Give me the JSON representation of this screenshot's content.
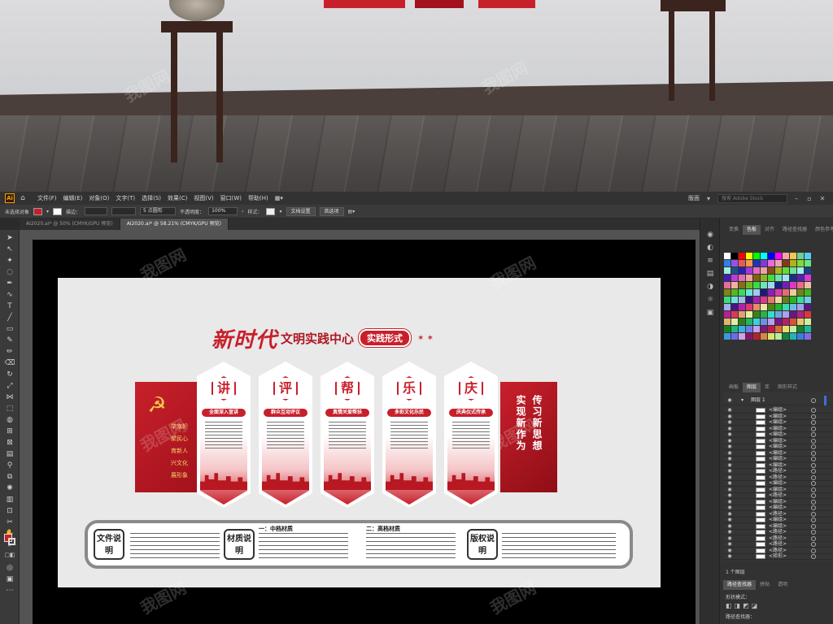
{
  "menubar": {
    "items": [
      "文件(F)",
      "编辑(E)",
      "对象(O)",
      "文字(T)",
      "选择(S)",
      "效果(C)",
      "视图(V)",
      "窗口(W)",
      "帮助(H)"
    ],
    "workspace": "版面",
    "search_placeholder": "搜索 Adobe Stock"
  },
  "control": {
    "selection": "未选择对象",
    "fill_color": "#c8202b",
    "stroke_label": "描边：",
    "brush": "5 点圆形",
    "opacity_label": "不透明度：",
    "opacity_value": "100%",
    "style_label": "样式：",
    "doc_setup": "文档设置",
    "preferences": "首选项"
  },
  "tabs": [
    {
      "label": "AI2020.ai* @ 50% (CMYK/GPU 预览)"
    },
    {
      "label": "AI2020.ai* @ 58.21% (CMYK/GPU 预览)"
    }
  ],
  "design": {
    "title_main": "新时代",
    "title_sub": "文明实践中心",
    "title_pill": "实践形式",
    "left_lines": [
      "举旗帜",
      "聚民心",
      "育新人",
      "兴文化",
      "展形象"
    ],
    "right_col1": "传习新思想",
    "right_col2": "实现新作为",
    "panels": [
      {
        "char": "讲",
        "label": "全面深入宣讲"
      },
      {
        "char": "评",
        "label": "群众互动评议"
      },
      {
        "char": "帮",
        "label": "真情关爱帮扶"
      },
      {
        "char": "乐",
        "label": "多彩文化乐民"
      },
      {
        "char": "庆",
        "label": "庆典仪式传承"
      }
    ],
    "info": {
      "file_note": "文件说明",
      "material_note": "材质说明",
      "mid_heading": "一：中档材质",
      "high_heading": "二：高档材质",
      "copyright_note": "版权说明"
    }
  },
  "right_panel": {
    "top_tabs": [
      "变换",
      "色板",
      "对齐",
      "路径查找器",
      "颜色参考"
    ],
    "mid_tabs": [
      "画板",
      "图层",
      "库",
      "图形样式"
    ],
    "layer_name": "图层 1",
    "layers": [
      "<编组>",
      "<编组>",
      "<编组>",
      "<编组>",
      "<编组>",
      "<编组>",
      "<编组>",
      "<编组>",
      "<编组>",
      "<编组>",
      "<路径>",
      "<路径>",
      "<编组>",
      "<编组>",
      "<路径>",
      "<编组>",
      "<编组>",
      "<路径>",
      "<编组>",
      "<编组>",
      "<路径>",
      "<路径>",
      "<路径>",
      "<路径>",
      "<矩形>"
    ],
    "layer_count": "1 个图层",
    "bottom_tabs": [
      "路径查找器",
      "拼贴",
      "透明"
    ],
    "shape_mode": "形状模式：",
    "pathfinder": "路径查找器："
  },
  "watermark": "我图网"
}
